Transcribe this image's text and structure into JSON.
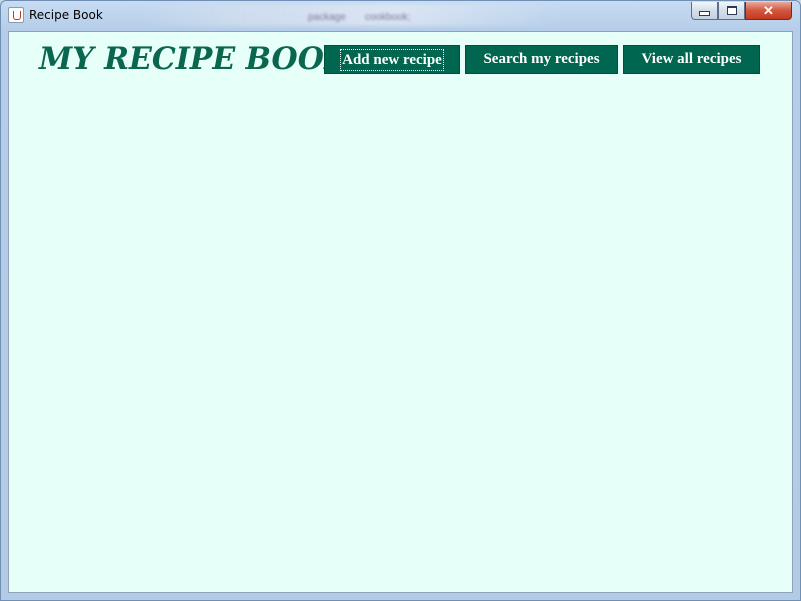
{
  "window": {
    "title": "Recipe Book",
    "background_behind": [
      "package",
      "cookbook;"
    ],
    "controls": {
      "minimize_icon": "minimize-icon",
      "maximize_icon": "maximize-icon",
      "close_icon": "close-icon",
      "close_glyph": "✕"
    }
  },
  "header": {
    "logo_text": "MY RECIPE BOOK"
  },
  "toolbar": {
    "add_label": "Add new recipe",
    "search_label": "Search my recipes",
    "view_label": "View all recipes"
  },
  "colors": {
    "accent": "#006650",
    "panel_background": "#e6fff9"
  }
}
